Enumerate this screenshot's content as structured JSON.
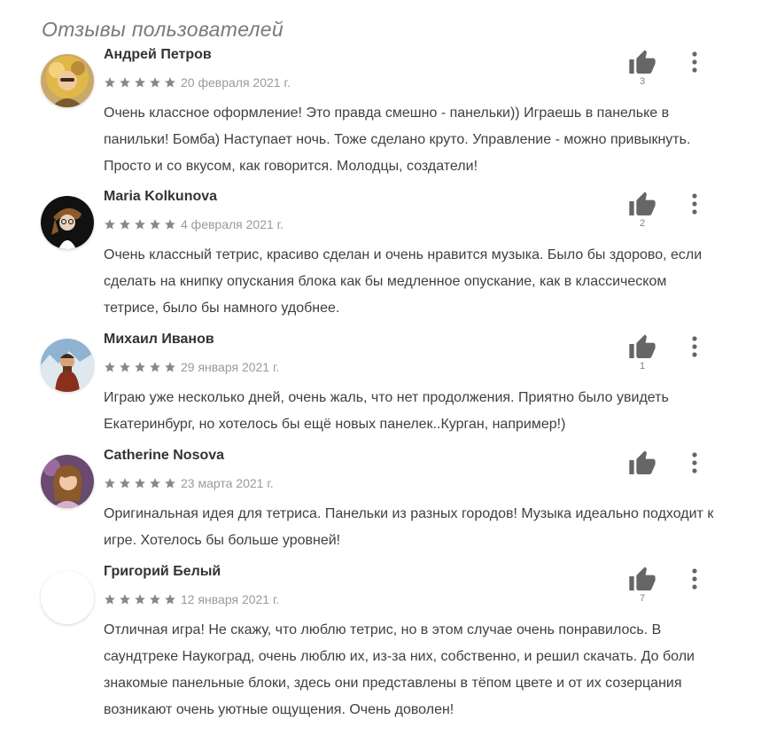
{
  "section_title": "Отзывы пользователей",
  "colors": {
    "star": "#888888",
    "icon": "#666666",
    "author": "#333333",
    "date": "#9a9a9a"
  },
  "icons": {
    "like": "thumbs-up-icon",
    "more": "more-vert-icon",
    "star": "star-icon"
  },
  "reviews": [
    {
      "author": "Андрей Петров",
      "rating": 5,
      "date": "20 февраля 2021 г.",
      "likes": "3",
      "text": "Очень классное оформление! Это правда смешно - панельки)) Играешь в панельке в панильки! Бомба) Наступает ночь. Тоже сделано круто. Управление - можно привыкнуть. Просто и со вкусом, как говорится. Молодцы, создатели!"
    },
    {
      "author": "Maria Kolkunova",
      "rating": 5,
      "date": "4 февраля 2021 г.",
      "likes": "2",
      "text": "Очень классный тетрис, красиво сделан и очень нравится музыка. Было бы здорово, если сделать на книпку опускания блока как бы медленное опускание, как в классическом тетрисе, было бы намного удобнее."
    },
    {
      "author": "Михаил Иванов",
      "rating": 5,
      "date": "29 января 2021 г.",
      "likes": "1",
      "text": "Играю уже несколько дней, очень жаль, что нет продолжения. Приятно было увидеть Екатеринбург, но хотелось бы ещё новых панелек..Курган, например!)"
    },
    {
      "author": "Catherine Nosova",
      "rating": 5,
      "date": "23 марта 2021 г.",
      "likes": "",
      "text": "Оригинальная идея для тетриса. Панельки из разных городов! Музыка идеально подходит к игре. Хотелось бы больше уровней!"
    },
    {
      "author": "Григорий Белый",
      "rating": 5,
      "date": "12 января 2021 г.",
      "likes": "7",
      "text": "Отличная игра! Не скажу, что люблю тетрис, но в этом случае очень понравилось. В саундтреке Наукоград, очень люблю их, из-за них, собственно, и решил скачать. До боли знакомые панельные блоки, здесь они представлены в тёпом цвете и от их созерцания возникают очень уютные ощущения. Очень доволен!"
    }
  ]
}
